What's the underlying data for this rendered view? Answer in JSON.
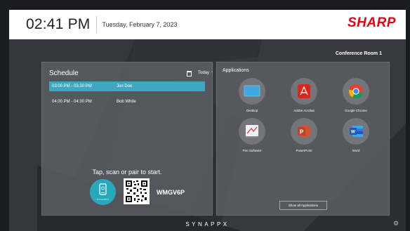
{
  "header": {
    "time": "02:41 PM",
    "date": "Tuesday, February 7, 2023",
    "brand": "SHARP",
    "brand_color": "#e60012"
  },
  "room": "Conference Room 1",
  "schedule": {
    "title": "Schedule",
    "today_label": "Today",
    "calendar_icon": "calendar-icon",
    "events": [
      {
        "time": "03:00 PM - 03:30 PM",
        "name": "Jon Doe",
        "highlighted": true
      },
      {
        "time": "04:00 PM - 04:30 PM",
        "name": "Bob White",
        "highlighted": false
      }
    ],
    "highlight_color": "#41a6c0"
  },
  "pairing": {
    "instruction": "Tap, scan or pair to start.",
    "nfc_label": "SYNAPPX",
    "code": "WMGV6P"
  },
  "applications": {
    "title": "Applications",
    "items": [
      {
        "label": "Desktop",
        "icon": "desktop-icon"
      },
      {
        "label": "Adobe Acrobat",
        "icon": "acrobat-icon"
      },
      {
        "label": "Google Chrome",
        "icon": "chrome-icon"
      },
      {
        "label": "Pen Software",
        "icon": "pen-software-icon"
      },
      {
        "label": "PowerPoint",
        "icon": "powerpoint-icon"
      },
      {
        "label": "Word",
        "icon": "word-icon"
      }
    ],
    "show_all_label": "Show all Applications"
  },
  "footer": {
    "logo": "SYNAPPX",
    "settings_icon": "gear-icon"
  }
}
